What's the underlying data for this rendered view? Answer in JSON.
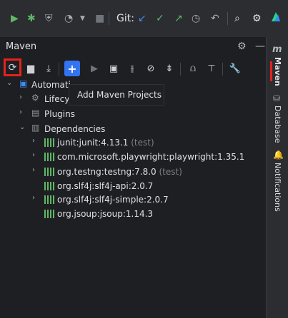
{
  "toolbar": {
    "git_label": "Git:",
    "icons": [
      "run-icon",
      "debug-icon",
      "coverage-icon",
      "profiler-icon",
      "stop-icon",
      "update-icon",
      "commit-icon",
      "push-icon",
      "history-icon",
      "rollback-icon",
      "search-icon",
      "settings-icon",
      "jetbrains-ai-icon"
    ]
  },
  "panel": {
    "title": "Maven",
    "tooltip": "Add Maven Projects"
  },
  "tree": {
    "root": "Automati",
    "lifecycle": "Lifecy",
    "plugins": "Plugins",
    "dependencies": "Dependencies",
    "items": [
      {
        "label": "junit:junit:4.13.1",
        "suffix": " (test)"
      },
      {
        "label": "com.microsoft.playwright:playwright:1.35.1",
        "suffix": ""
      },
      {
        "label": "org.testng:testng:7.8.0",
        "suffix": " (test)"
      },
      {
        "label": "org.slf4j:slf4j-api:2.0.7",
        "suffix": ""
      },
      {
        "label": "org.slf4j:slf4j-simple:2.0.7",
        "suffix": ""
      },
      {
        "label": "org.jsoup:jsoup:1.14.3",
        "suffix": ""
      }
    ]
  },
  "sidebar": {
    "tabs": [
      "Maven",
      "Database",
      "Notifications"
    ],
    "active_tab": "Maven"
  },
  "colors": {
    "accent": "#3574f0",
    "highlight": "#e5221d",
    "run_green": "#5fb865"
  }
}
